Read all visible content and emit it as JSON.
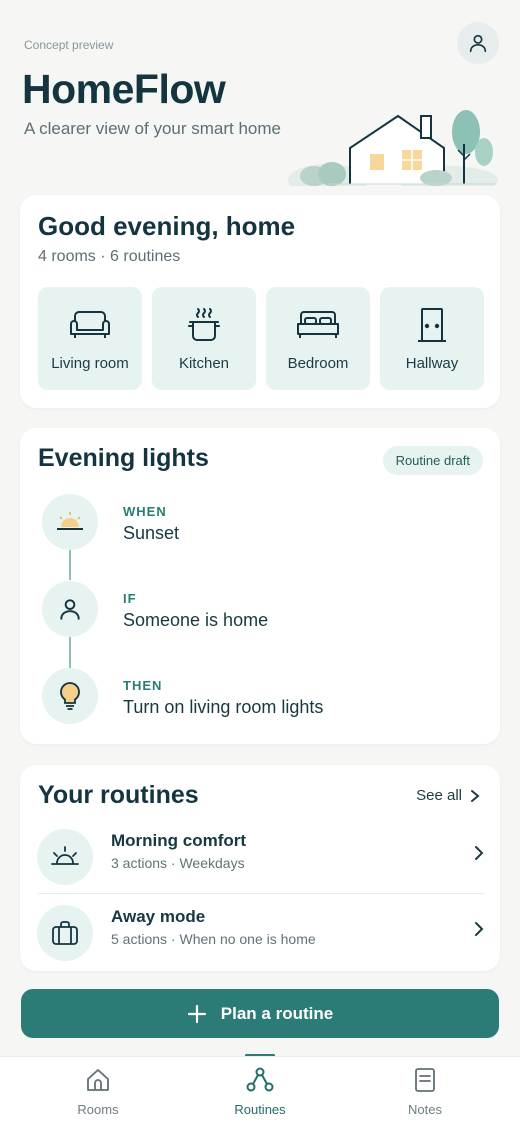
{
  "header": {
    "concept_label": "Concept preview",
    "app_title": "HomeFlow",
    "subtitle": "A clearer view of your smart home",
    "profile_icon": "person-icon"
  },
  "home_summary": {
    "greeting": "Good evening, home",
    "meta": "4 rooms · 6 routines",
    "rooms": [
      {
        "label": "Living room",
        "icon": "sofa-icon"
      },
      {
        "label": "Kitchen",
        "icon": "pot-icon"
      },
      {
        "label": "Bedroom",
        "icon": "bed-icon"
      },
      {
        "label": "Hallway",
        "icon": "door-icon"
      }
    ]
  },
  "evening_lights": {
    "title": "Evening lights",
    "chip": "Routine draft",
    "steps": [
      {
        "kicker": "WHEN",
        "text": "Sunset",
        "icon": "sunset-icon"
      },
      {
        "kicker": "IF",
        "text": "Someone is home",
        "icon": "person-icon"
      },
      {
        "kicker": "THEN",
        "text": "Turn on living room lights",
        "icon": "lightbulb-icon"
      }
    ]
  },
  "your_routines": {
    "title": "Your routines",
    "see_all": "See all",
    "items": [
      {
        "name": "Morning comfort",
        "meta": "3 actions · Weekdays",
        "icon": "sunrise-icon"
      },
      {
        "name": "Away mode",
        "meta": "5 actions · When no one is home",
        "icon": "suitcase-icon"
      }
    ]
  },
  "cta": {
    "label": "Plan a routine",
    "icon": "plus-icon"
  },
  "tabs": [
    {
      "label": "Rooms",
      "icon": "house-icon",
      "active": false
    },
    {
      "label": "Routines",
      "icon": "routine-graph-icon",
      "active": true
    },
    {
      "label": "Notes",
      "icon": "notes-icon",
      "active": false
    }
  ],
  "colors": {
    "accent": "#2b7b76",
    "tint": "#e6f3f1",
    "text_dark": "#143540",
    "background": "#f6f7f5"
  }
}
